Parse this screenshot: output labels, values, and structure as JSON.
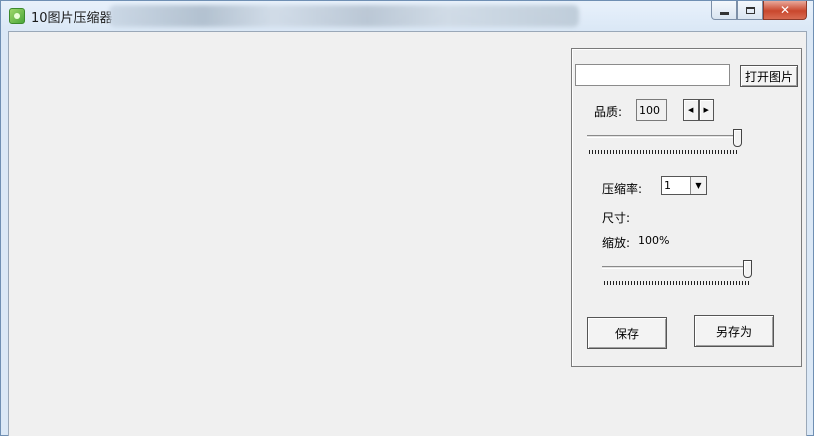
{
  "window": {
    "title": "10图片压缩器",
    "buttons": {
      "minimize": "",
      "maximize": "",
      "close": "✕"
    }
  },
  "panel": {
    "path_value": "",
    "open_button": "打开图片",
    "quality": {
      "label": "品质:",
      "value": "100",
      "slider_level_percent": 100
    },
    "compression": {
      "label": "压缩率:",
      "selected": "1"
    },
    "size_label": "尺寸:",
    "zoom": {
      "label": "缩放:",
      "value": "100%",
      "slider_level_percent": 100
    },
    "save_button": "保存",
    "save_as_button": "另存为"
  },
  "icons": {
    "app": "app-picture-icon",
    "spin_left": "arrow-left-icon",
    "spin_right": "arrow-right-icon",
    "dropdown": "chevron-down-icon"
  }
}
